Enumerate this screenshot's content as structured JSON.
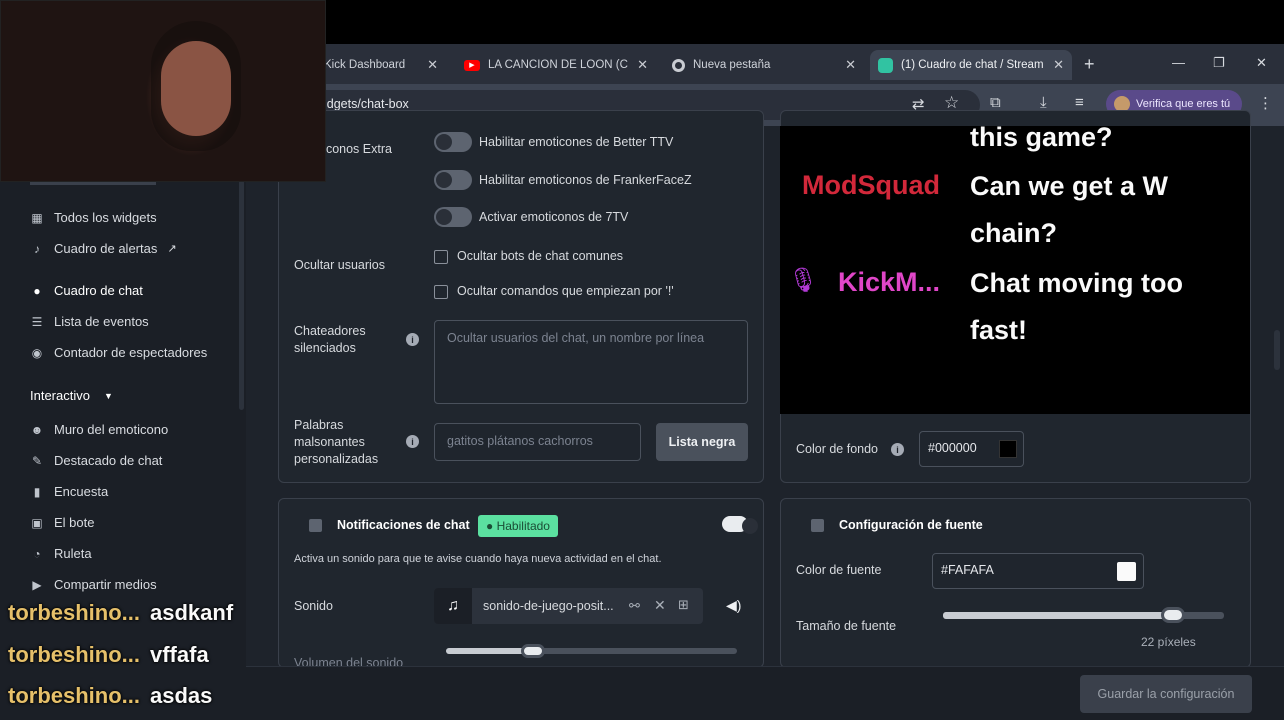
{
  "browser": {
    "tabs": [
      {
        "label": "Kick Dashboard"
      },
      {
        "label": "LA CANCION DE LOON (Can"
      },
      {
        "label": "Nueva pestaña"
      },
      {
        "label": "(1) Cuadro de chat / Stream"
      }
    ],
    "url": "idgets/chat-box",
    "verify_label": "Verifica que eres tú",
    "new_tab": "+"
  },
  "sidebar": {
    "items": [
      {
        "label": "Todos los widgets",
        "icon": "grid-icon"
      },
      {
        "label": "Cuadro de alertas",
        "icon": "bell-icon"
      },
      {
        "label": "Cuadro de chat",
        "icon": "chat-icon"
      },
      {
        "label": "Lista de eventos",
        "icon": "list-icon"
      },
      {
        "label": "Contador de espectadores",
        "icon": "eye-icon"
      }
    ],
    "section": "Interactivo",
    "interactive": [
      {
        "label": "Muro del emoticono"
      },
      {
        "label": "Destacado de chat"
      },
      {
        "label": "Encuesta"
      },
      {
        "label": "El bote"
      },
      {
        "label": "Ruleta"
      },
      {
        "label": "Compartir medios"
      }
    ]
  },
  "settings": {
    "emotes_label": "Emoticonos Extra",
    "toggle_bttv": "Habilitar emoticones de Better TTV",
    "toggle_ffz": "Habilitar emoticonos de FrankerFaceZ",
    "toggle_7tv": "Activar emoticonos de 7TV",
    "hide_users_label": "Ocultar usuarios",
    "hide_bots": "Ocultar bots de chat comunes",
    "hide_commands": "Ocultar comandos que empiezan por '!'",
    "muted_label_1": "Chateadores",
    "muted_label_2": "silenciados",
    "muted_placeholder": "Ocultar usuarios del chat, un nombre por línea",
    "badwords_label_1": "Palabras",
    "badwords_label_2": "malsonantes",
    "badwords_label_3": "personalizadas",
    "badwords_placeholder": "gatitos plátanos cachorros",
    "blacklist_button": "Lista negra"
  },
  "preview": {
    "messages": [
      {
        "user": "",
        "text": "this game?",
        "color": "#e0293b"
      },
      {
        "user": "ModSquad",
        "text_1": "Can we get a W",
        "text_2": "chain?",
        "color": "#d2283a"
      },
      {
        "user": "KickM...",
        "text_1": "Chat moving too",
        "text_2": "fast!",
        "color": "#e046c8"
      }
    ],
    "bg_label": "Color de fondo",
    "bg_value": "#000000"
  },
  "notifications": {
    "title": "Notificaciones de chat",
    "badge": "Habilitado",
    "desc": "Activa un sonido para que te avise cuando haya nueva actividad en el chat.",
    "sound_label": "Sonido",
    "sound_file": "sonido-de-juego-posit...",
    "volume_label": "Volumen del sonido",
    "volume_level": 0.3
  },
  "font": {
    "title": "Configuración de fuente",
    "color_label": "Color de fuente",
    "color_value": "#FAFAFA",
    "size_label": "Tamaño de fuente",
    "size_value": "22 píxeles",
    "size_level": 0.82
  },
  "save_button": "Guardar la configuración",
  "stream_overlay": [
    {
      "user": "torbeshino...",
      "msg": "asdkanf"
    },
    {
      "user": "torbeshino...",
      "msg": "vffafa"
    },
    {
      "user": "torbeshino...",
      "msg": "asdas"
    }
  ],
  "colors": {
    "accent_green": "#5be0a0",
    "badge_text": "#1b4d35",
    "bg": "#1e232b"
  }
}
